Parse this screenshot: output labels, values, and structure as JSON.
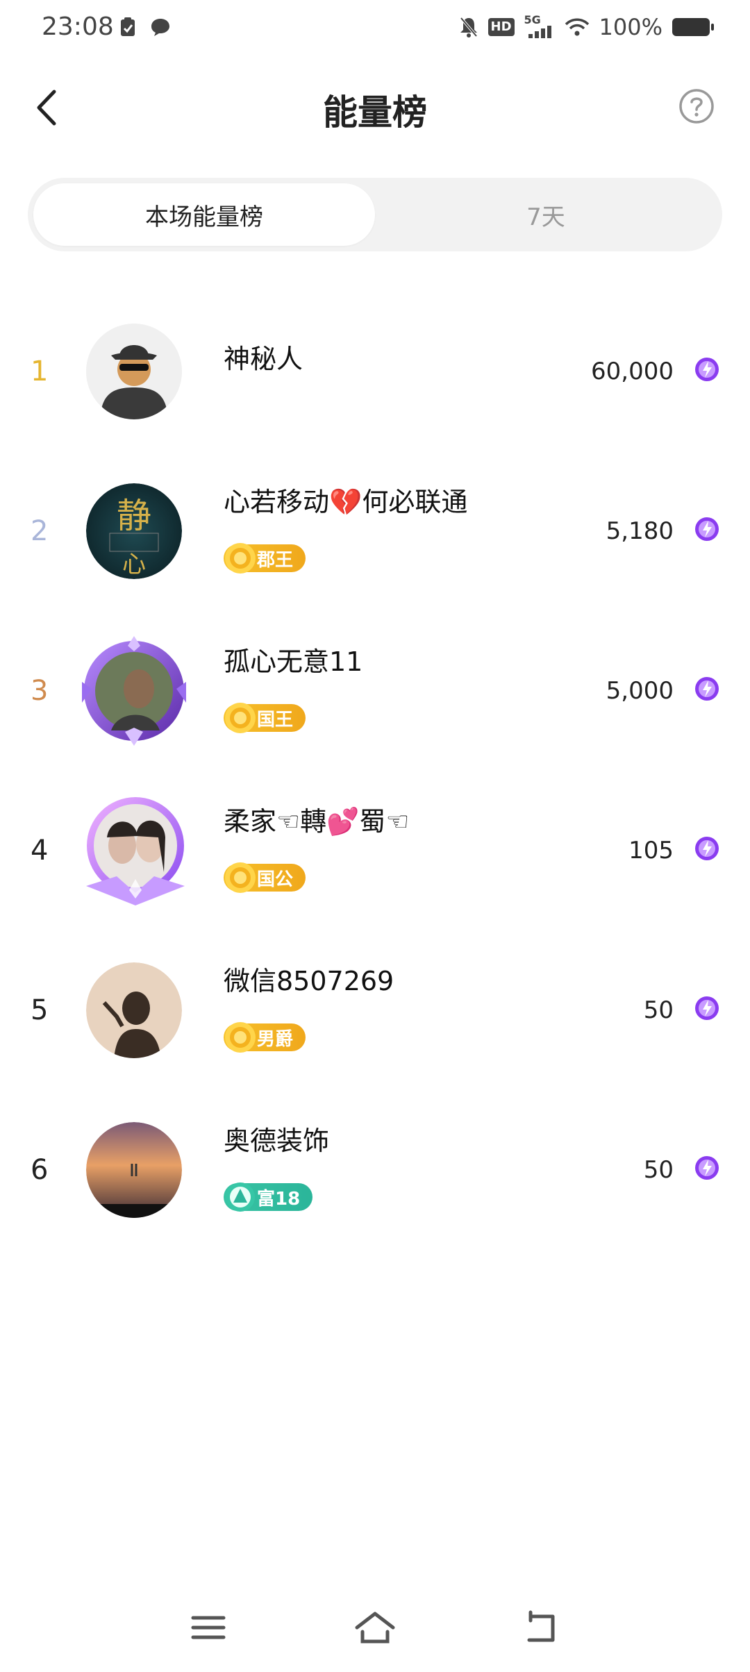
{
  "status_bar": {
    "time": "23:08",
    "battery_text": "100%",
    "network_text": "5G",
    "hd_text": "HD"
  },
  "header": {
    "title": "能量榜"
  },
  "tabs": [
    {
      "label": "本场能量榜",
      "active": true
    },
    {
      "label": "7天",
      "active": false
    }
  ],
  "ranking": [
    {
      "rank": "1",
      "rank_color": "#e5b52f",
      "name": "神秘人",
      "badge": null,
      "score": "60,000",
      "avatar": "mystery-person"
    },
    {
      "rank": "2",
      "rank_color": "#a9b5d9",
      "name": "心若移动💔何必联通",
      "badge": {
        "label": "郡王",
        "type": "gold"
      },
      "score": "5,180",
      "avatar": "dark-blue-calligraphy"
    },
    {
      "rank": "3",
      "rank_color": "#d08b4e",
      "name": "孤心无意11",
      "badge": {
        "label": "国王",
        "type": "gold"
      },
      "score": "5,000",
      "avatar": "purple-frame-photo"
    },
    {
      "rank": "4",
      "rank_color": "#222222",
      "name": "柔家☜轉💕蜀☜",
      "badge": {
        "label": "国公",
        "type": "gold"
      },
      "score": "105",
      "avatar": "purple-frame-couple"
    },
    {
      "rank": "5",
      "rank_color": "#222222",
      "name": "微信8507269",
      "badge": {
        "label": "男爵",
        "type": "gold"
      },
      "score": "50",
      "avatar": "silhouette"
    },
    {
      "rank": "6",
      "rank_color": "#222222",
      "name": "奥德装饰",
      "badge": {
        "label": "富18",
        "type": "green"
      },
      "score": "50",
      "avatar": "sunset"
    }
  ],
  "colors": {
    "gold_badge": "#f0a81c",
    "green_badge": "#2bb59a",
    "energy_purple": "#8a3cf0"
  }
}
